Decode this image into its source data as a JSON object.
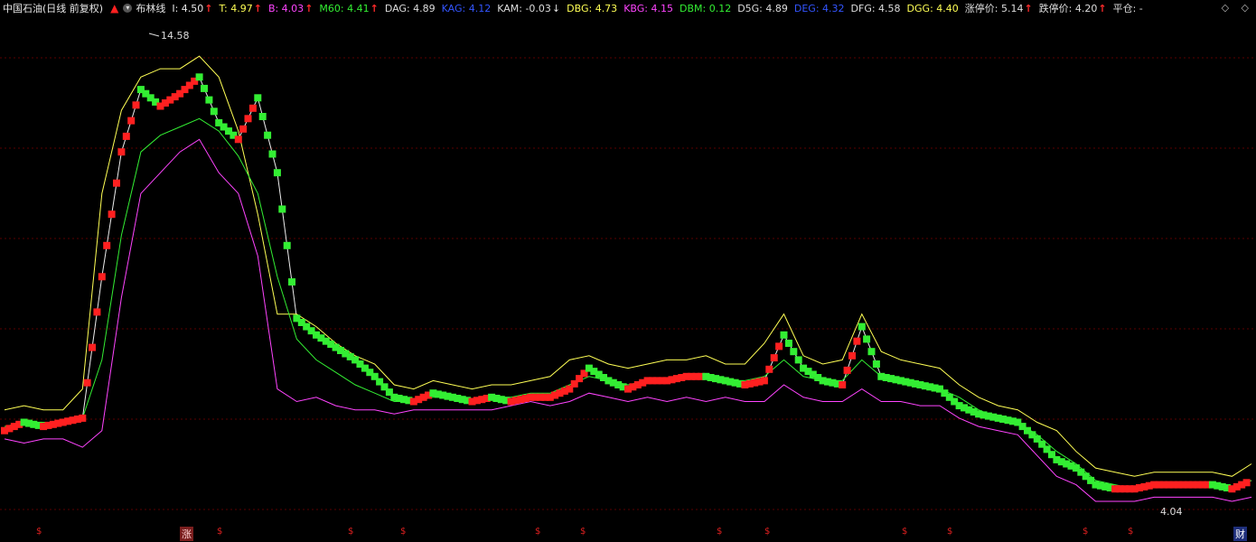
{
  "header": {
    "stock_name": "中国石油(日线 前复权)",
    "indicator_name": "布林线",
    "items": [
      {
        "label": "I: 4.50",
        "color": "#e6e6e6",
        "arrow": "↑",
        "arrow_type": "up"
      },
      {
        "label": "T: 4.97",
        "color": "#ffff55",
        "arrow": "↑",
        "arrow_type": "up"
      },
      {
        "label": "B: 4.03",
        "color": "#ff44ff",
        "arrow": "↑",
        "arrow_type": "up"
      },
      {
        "label": "M60: 4.41",
        "color": "#33ee33",
        "arrow": "↑",
        "arrow_type": "up"
      },
      {
        "label": "DAG: 4.89",
        "color": "#dddddd",
        "arrow": "",
        "arrow_type": ""
      },
      {
        "label": "KAG: 4.12",
        "color": "#3355ff",
        "arrow": "",
        "arrow_type": ""
      },
      {
        "label": "KAM: -0.03",
        "color": "#dddddd",
        "arrow": "↓",
        "arrow_type": "down"
      },
      {
        "label": "DBG: 4.73",
        "color": "#ffff55",
        "arrow": "",
        "arrow_type": ""
      },
      {
        "label": "KBG: 4.15",
        "color": "#ff44ff",
        "arrow": "",
        "arrow_type": ""
      },
      {
        "label": "DBM: 0.12",
        "color": "#33ee33",
        "arrow": "",
        "arrow_type": ""
      },
      {
        "label": "D5G: 4.89",
        "color": "#dddddd",
        "arrow": "",
        "arrow_type": ""
      },
      {
        "label": "DEG: 4.32",
        "color": "#3355ff",
        "arrow": "",
        "arrow_type": ""
      },
      {
        "label": "DFG: 4.58",
        "color": "#dddddd",
        "arrow": "",
        "arrow_type": ""
      },
      {
        "label": "DGG: 4.40",
        "color": "#ffff55",
        "arrow": "",
        "arrow_type": ""
      },
      {
        "label": "涨停价: 5.14",
        "color": "#dddddd",
        "arrow": "↑",
        "arrow_type": "up"
      },
      {
        "label": "跌停价: 4.20",
        "color": "#dddddd",
        "arrow": "↑",
        "arrow_type": "up"
      },
      {
        "label": "平仓: -",
        "color": "#dddddd",
        "arrow": "",
        "arrow_type": ""
      }
    ],
    "corner_icons": [
      "◇",
      "◇"
    ]
  },
  "price_labels": {
    "high": "14.58",
    "low": "4.04"
  },
  "bottom_markers": {
    "dollar": "$",
    "zhang": "涨",
    "cai": "财"
  },
  "colors": {
    "grid": "#5a0000",
    "upper_band": "#ffff55",
    "mid_band": "#33ee33",
    "lower_band": "#ff44ff",
    "ma_white": "#eeeeee",
    "up_marker": "#ff2020",
    "down_marker": "#33ee33"
  },
  "chart_data": {
    "type": "line",
    "title": "",
    "xlabel": "",
    "ylabel": "",
    "ylim": [
      3.6,
      15.5
    ],
    "series": [
      {
        "name": "I",
        "values": [
          5.8,
          6.0,
          5.9,
          6.0,
          6.1,
          9.5,
          12.5,
          14.0,
          13.6,
          13.9,
          14.3,
          13.2,
          12.8,
          13.8,
          12.0,
          8.5,
          8.1,
          7.8,
          7.5,
          7.1,
          6.6,
          6.5,
          6.7,
          6.6,
          6.5,
          6.6,
          6.5,
          6.6,
          6.6,
          6.8,
          7.3,
          7.0,
          6.8,
          7.0,
          7.0,
          7.1,
          7.1,
          7.0,
          6.9,
          7.0,
          8.1,
          7.3,
          7.0,
          6.9,
          8.3,
          7.1,
          7.0,
          6.9,
          6.8,
          6.4,
          6.2,
          6.1,
          6.0,
          5.6,
          5.1,
          4.9,
          4.5,
          4.4,
          4.4,
          4.5,
          4.5,
          4.5,
          4.5,
          4.4,
          4.6
        ]
      },
      {
        "name": "T",
        "values": [
          6.3,
          6.4,
          6.3,
          6.3,
          6.8,
          11.5,
          13.5,
          14.3,
          14.5,
          14.5,
          14.8,
          14.3,
          13.0,
          11.0,
          8.6,
          8.6,
          8.3,
          7.9,
          7.6,
          7.4,
          6.9,
          6.8,
          7.0,
          6.9,
          6.8,
          6.9,
          6.9,
          7.0,
          7.1,
          7.5,
          7.6,
          7.4,
          7.3,
          7.4,
          7.5,
          7.5,
          7.6,
          7.4,
          7.4,
          7.9,
          8.6,
          7.6,
          7.4,
          7.5,
          8.6,
          7.7,
          7.5,
          7.4,
          7.3,
          6.9,
          6.6,
          6.4,
          6.3,
          6.0,
          5.8,
          5.3,
          4.9,
          4.8,
          4.7,
          4.8,
          4.8,
          4.8,
          4.8,
          4.7,
          5.0
        ]
      },
      {
        "name": "B",
        "values": [
          5.6,
          5.5,
          5.6,
          5.6,
          5.4,
          5.8,
          9.0,
          11.5,
          12.0,
          12.5,
          12.8,
          12.0,
          11.5,
          10.0,
          6.8,
          6.5,
          6.6,
          6.4,
          6.3,
          6.3,
          6.2,
          6.3,
          6.3,
          6.3,
          6.3,
          6.3,
          6.4,
          6.5,
          6.4,
          6.5,
          6.7,
          6.6,
          6.5,
          6.6,
          6.5,
          6.6,
          6.5,
          6.6,
          6.5,
          6.5,
          6.9,
          6.6,
          6.5,
          6.5,
          6.8,
          6.5,
          6.5,
          6.4,
          6.4,
          6.1,
          5.9,
          5.8,
          5.7,
          5.2,
          4.7,
          4.5,
          4.1,
          4.1,
          4.1,
          4.2,
          4.2,
          4.2,
          4.2,
          4.1,
          4.2
        ]
      },
      {
        "name": "M60",
        "values": [
          5.9,
          6.0,
          6.0,
          6.0,
          6.1,
          7.5,
          10.5,
          12.5,
          12.9,
          13.1,
          13.3,
          13.0,
          12.4,
          11.5,
          9.5,
          8.0,
          7.5,
          7.2,
          6.9,
          6.7,
          6.5,
          6.5,
          6.6,
          6.6,
          6.5,
          6.6,
          6.6,
          6.7,
          6.7,
          6.9,
          7.1,
          7.0,
          6.9,
          7.0,
          7.0,
          7.1,
          7.1,
          7.0,
          7.0,
          7.1,
          7.5,
          7.1,
          7.0,
          7.0,
          7.5,
          7.1,
          7.0,
          6.9,
          6.8,
          6.6,
          6.3,
          6.1,
          6.0,
          5.7,
          5.3,
          5.0,
          4.6,
          4.5,
          4.4,
          4.5,
          4.5,
          4.5,
          4.5,
          4.4,
          4.6
        ]
      }
    ]
  }
}
